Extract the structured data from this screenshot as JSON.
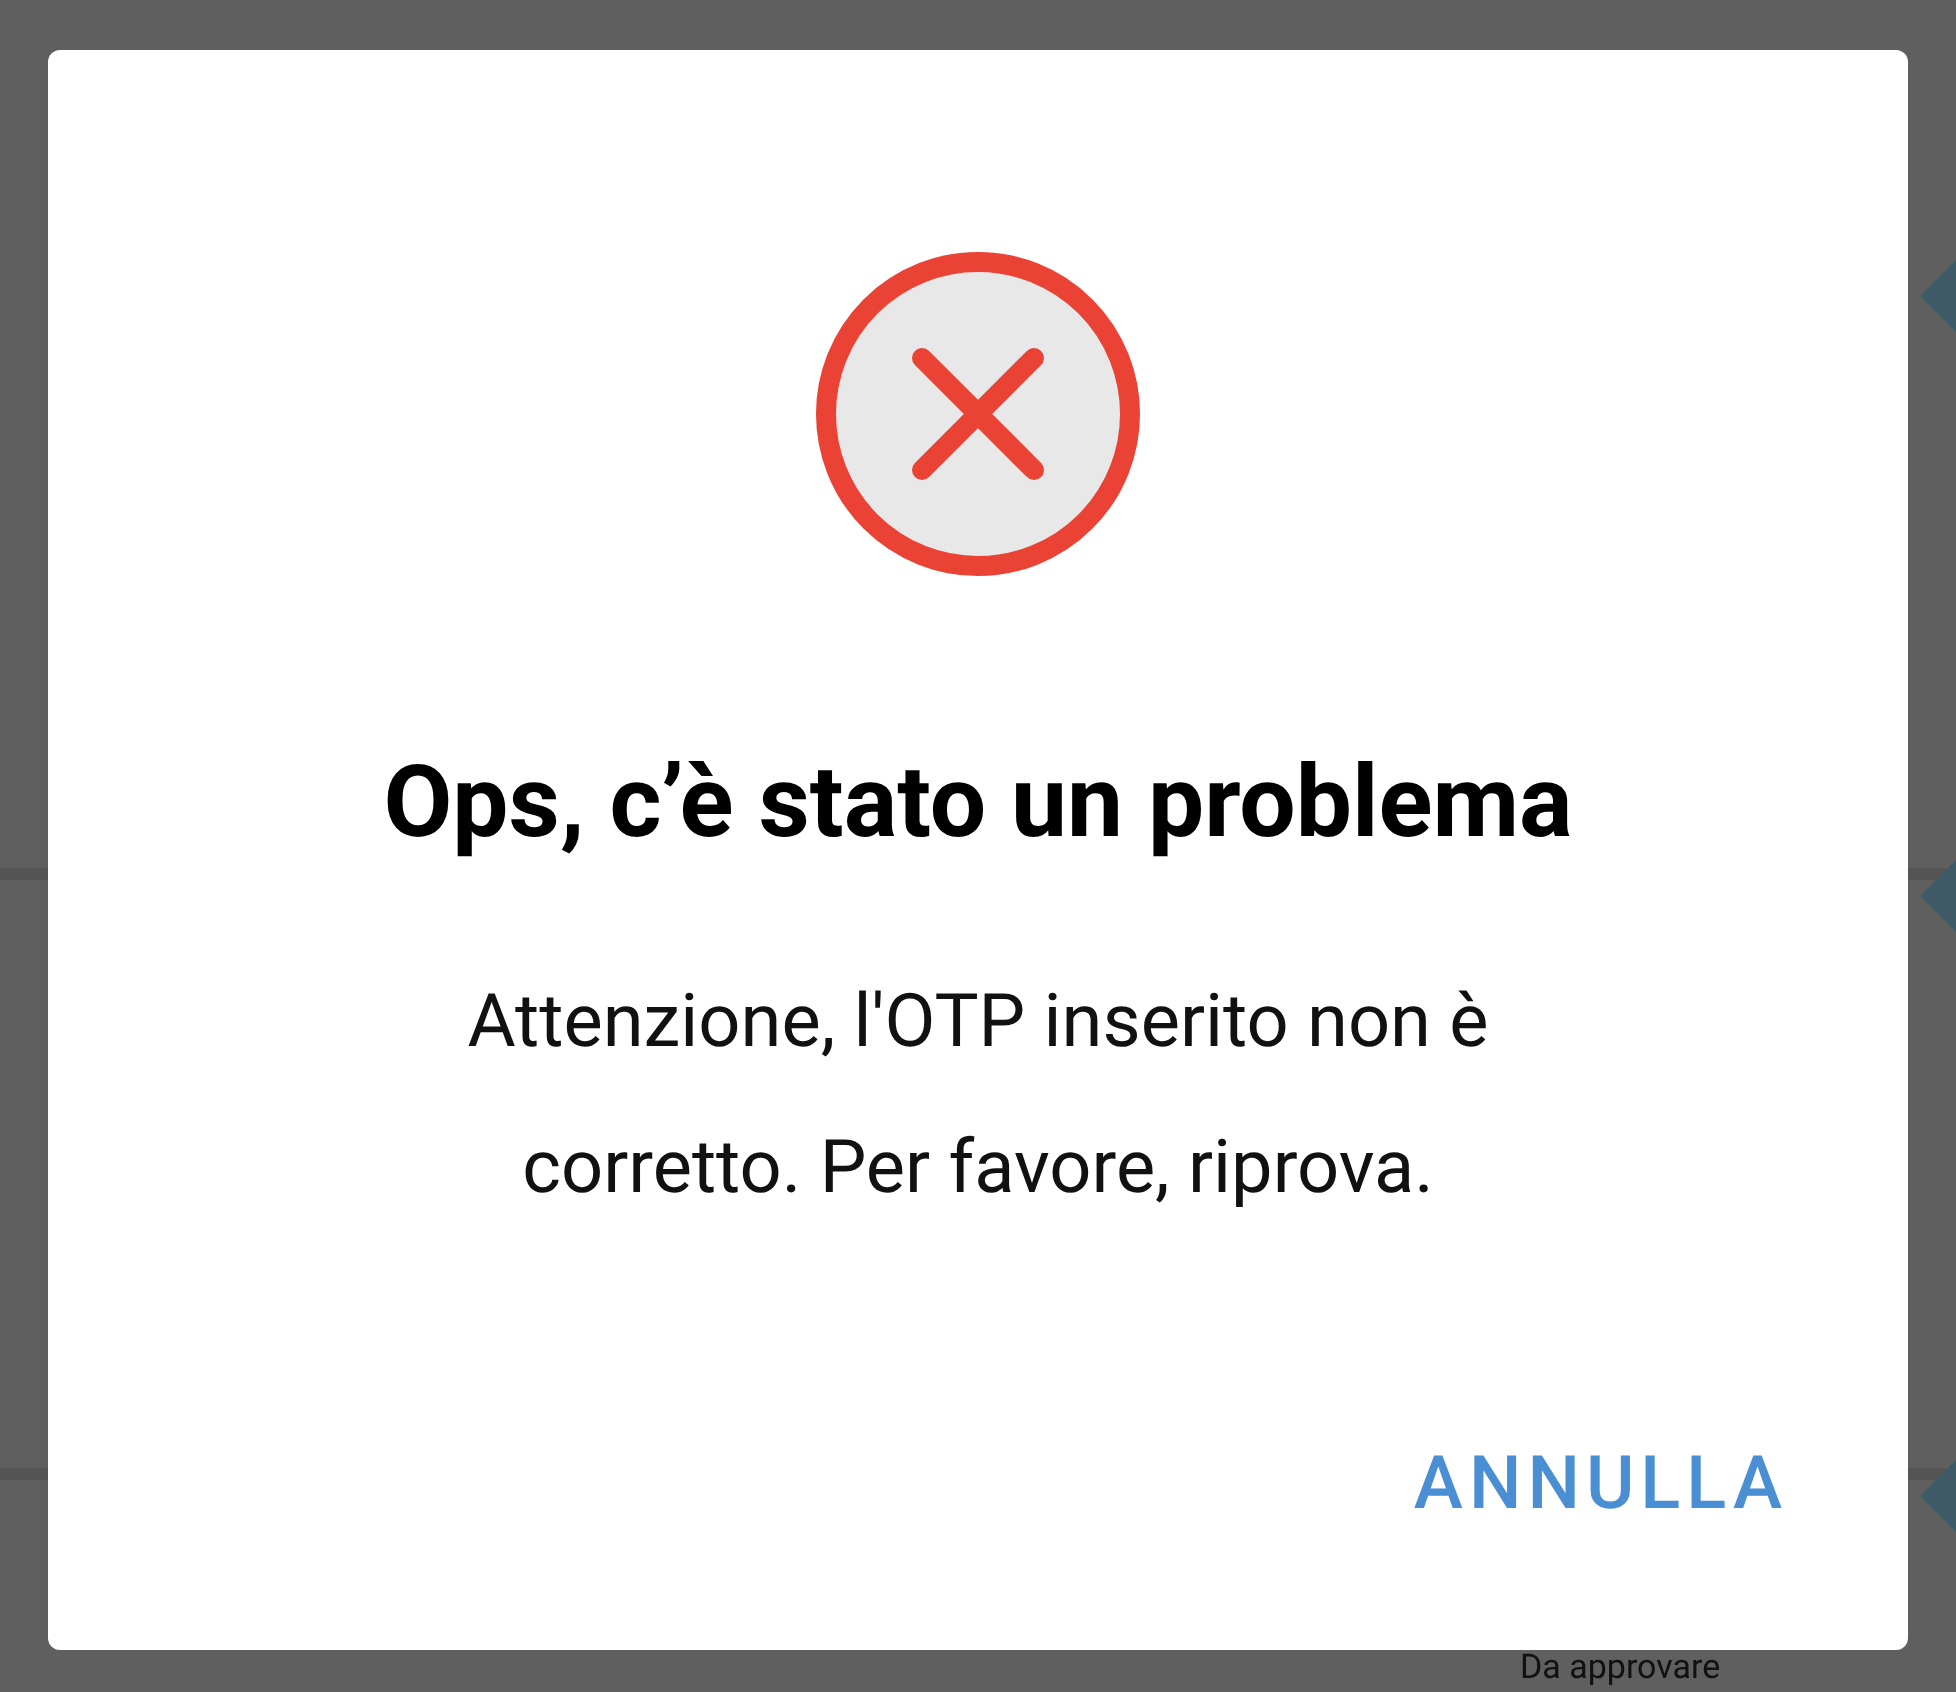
{
  "background": {
    "status": "Da approvare"
  },
  "dialog": {
    "title": "Ops, c’è stato un problema",
    "message": "Attenzione, l'OTP inserito non è corretto. Per favore, riprova.",
    "buttons": [
      "ANNULLA"
    ]
  }
}
